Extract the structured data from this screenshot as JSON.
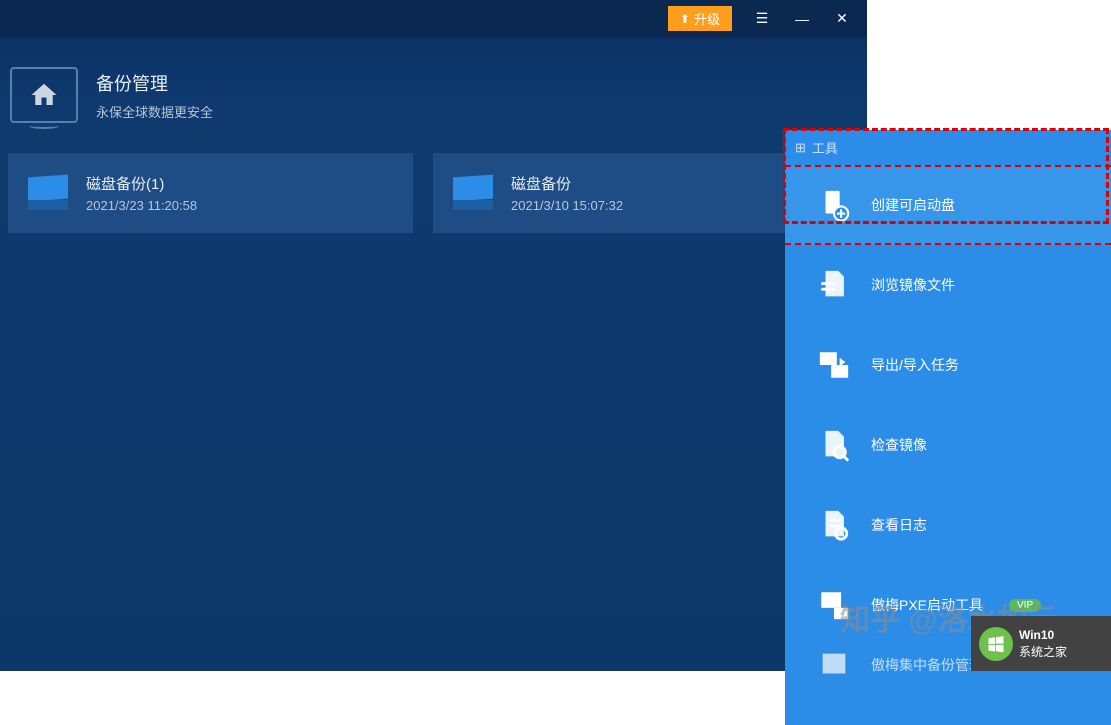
{
  "titlebar": {
    "upgrade_label": "升级"
  },
  "header": {
    "title": "备份管理",
    "subtitle": "永保全球数据更安全"
  },
  "backups": [
    {
      "title": "磁盘备份(1)",
      "date": "2021/3/23 11:20:58"
    },
    {
      "title": "磁盘备份",
      "date": "2021/3/10 15:07:32"
    }
  ],
  "tools": {
    "header": "工具",
    "items": [
      {
        "label": "创建可启动盘",
        "highlighted": true
      },
      {
        "label": "浏览镜像文件"
      },
      {
        "label": "导出/导入任务"
      },
      {
        "label": "检查镜像"
      },
      {
        "label": "查看日志"
      },
      {
        "label": "傲梅PXE启动工具",
        "vip": "VIP"
      },
      {
        "label": "傲梅集中备份管理"
      }
    ]
  },
  "watermark": "知乎 @洛水如云",
  "badge": {
    "line1": "Win10",
    "line2": "系统之家"
  }
}
